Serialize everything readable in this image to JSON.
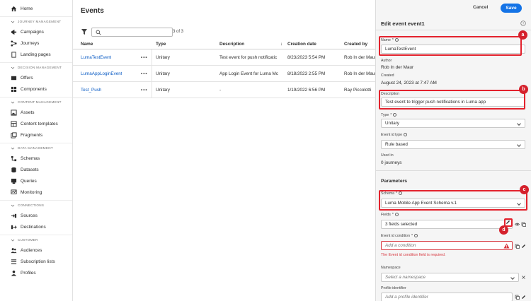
{
  "sidebar": {
    "home": "Home",
    "sections": [
      {
        "title": "JOURNEY MANAGEMENT",
        "items": [
          "Campaigns",
          "Journeys",
          "Landing pages"
        ]
      },
      {
        "title": "DECISION MANAGEMENT",
        "items": [
          "Offers",
          "Components"
        ]
      },
      {
        "title": "CONTENT MANAGEMENT",
        "items": [
          "Assets",
          "Content templates",
          "Fragments"
        ]
      },
      {
        "title": "DATA MANAGEMENT",
        "items": [
          "Schemas",
          "Datasets",
          "Queries",
          "Monitoring"
        ]
      },
      {
        "title": "CONNECTIONS",
        "items": [
          "Sources",
          "Destinations"
        ]
      },
      {
        "title": "CUSTOMER",
        "items": [
          "Audiences",
          "Subscription lists",
          "Profiles"
        ]
      }
    ],
    "icons": {
      "home": "home-icon",
      "campaigns": "megaphone-icon",
      "journeys": "journey-icon",
      "landing_pages": "document-icon",
      "offers": "offer-icon",
      "components": "components-icon",
      "assets": "assets-icon",
      "content_templates": "templates-icon",
      "fragments": "fragments-icon",
      "schemas": "schema-icon",
      "datasets": "dataset-icon",
      "queries": "query-icon",
      "monitoring": "monitor-icon",
      "sources": "sources-icon",
      "destinations": "destinations-icon",
      "audiences": "audiences-icon",
      "subscription_lists": "list-icon",
      "profiles": "profile-icon"
    }
  },
  "main": {
    "title": "Events",
    "search_placeholder": "",
    "count": "3 of 3",
    "columns": {
      "name": "Name",
      "type": "Type",
      "description": "Description",
      "creation_date": "Creation date",
      "created_by": "Created by"
    },
    "rows": [
      {
        "name": "LumaTestEvent",
        "more": "•••",
        "type": "Unitary",
        "description": "Test event for push notificatic",
        "date": "8/23/2023 5:54 PM",
        "by": "Rob In der Maur"
      },
      {
        "name": "LumaAppLoginEvent",
        "more": "•••",
        "type": "Unitary",
        "description": "App Login Event for Luma Mc",
        "date": "8/18/2023 2:55 PM",
        "by": "Rob In der Maur"
      },
      {
        "name": "Test_Push",
        "more": "•••",
        "type": "Unitary",
        "description": "-",
        "date": "1/19/2022 6:56 PM",
        "by": "Ray Piccolotti"
      }
    ]
  },
  "panel": {
    "cancel": "Cancel",
    "save": "Save",
    "title": "Edit event event1",
    "name_label": "Name",
    "name_value": "LumaTestEvent",
    "author_label": "Author",
    "author_value": "Rob In der Maur",
    "created_label": "Created",
    "created_value": "August 24, 2023 at 7:47 AM",
    "description_label": "Description",
    "description_value": "Test event to trigger push notifications in Luma app",
    "type_label": "Type",
    "type_value": "Unitary",
    "event_id_type_label": "Event id type",
    "event_id_type_value": "Rule based",
    "used_in_label": "Used in",
    "used_in_value": "0 journeys",
    "parameters_title": "Parameters",
    "schema_label": "Schema",
    "schema_value": "Luma Mobile App Event Schema v.1",
    "fields_label": "Fields",
    "fields_value": "3 fields selected",
    "event_id_condition_label": "Event id condition",
    "event_id_condition_placeholder": "Add a condition",
    "event_id_condition_error": "The Event id condition field is required.",
    "namespace_label": "Namespace",
    "namespace_placeholder": "Select a namespace",
    "profile_identifier_label": "Profile identifier",
    "profile_identifier_placeholder": "Add a profile identifier",
    "required_marker": "*",
    "badges": [
      "a",
      "b",
      "c",
      "d"
    ],
    "accent_color": "#1473e6",
    "highlight_color": "#e3222d"
  }
}
